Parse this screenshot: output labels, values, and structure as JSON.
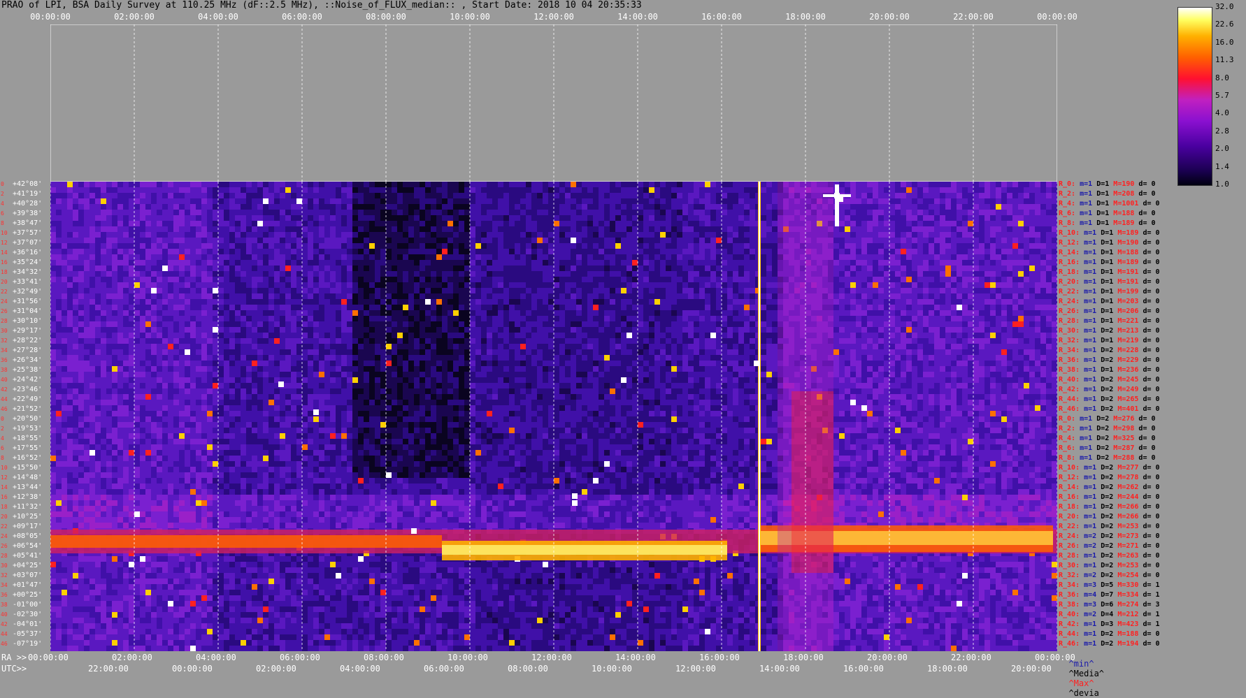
{
  "title": "PRAO of LPI, BSA Daily Survey at 110.25 MHz (dF::2.5 MHz), ::Noise_of_FLUX_median:: , Start Date: 2018 10 04 20:35:33",
  "top_axis": [
    "00:00:00",
    "02:00:00",
    "04:00:00",
    "06:00:00",
    "08:00:00",
    "10:00:00",
    "12:00:00",
    "14:00:00",
    "16:00:00",
    "18:00:00",
    "20:00:00",
    "22:00:00",
    "00:00:00"
  ],
  "bottom_ra_label": "RA >>",
  "bottom_ra": [
    "00:00:00",
    "02:00:00",
    "04:00:00",
    "06:00:00",
    "08:00:00",
    "10:00:00",
    "12:00:00",
    "14:00:00",
    "16:00:00",
    "18:00:00",
    "20:00:00",
    "22:00:00",
    "00:00:00"
  ],
  "bottom_utc_label": "UTC>>",
  "bottom_utc": [
    "22:00:00",
    "00:00:00",
    "02:00:00",
    "04:00:00",
    "06:00:00",
    "08:00:00",
    "10:00:00",
    "12:00:00",
    "14:00:00",
    "16:00:00",
    "18:00:00",
    "20:00:00"
  ],
  "colorbar": {
    "labels": [
      "32.0",
      "22.6",
      "16.0",
      "11.3",
      "8.0",
      "5.7",
      "4.0",
      "2.8",
      "2.0",
      "1.4",
      "1.0"
    ]
  },
  "declinations": [
    "+42°08'",
    "+41°19'",
    "+40°28'",
    "+39°38'",
    "+38°47'",
    "+37°57'",
    "+37°07'",
    "+36°16'",
    "+35°24'",
    "+34°32'",
    "+33°41'",
    "+32°49'",
    "+31°56'",
    "+31°04'",
    "+30°10'",
    "+29°17'",
    "+28°22'",
    "+27°28'",
    "+26°34'",
    "+25°38'",
    "+24°42'",
    "+23°46'",
    "+22°49'",
    "+21°52'",
    "+20°50'",
    "+19°53'",
    "+18°55'",
    "+17°55'",
    "+16°52'",
    "+15°50'",
    "+14°48'",
    "+13°44'",
    "+12°38'",
    "+11°32'",
    "+10°25'",
    "+09°17'",
    "+08°05'",
    "+06°54'",
    "+05°41'",
    "+04°25'",
    "+03°07'",
    "+01°47'",
    "+00°25'",
    "-01°00'",
    "-02°30'",
    "-04°01'",
    "-05°37'",
    "-07°19'"
  ],
  "row_index": [
    "0",
    "2",
    "4",
    "6",
    "8",
    "10",
    "12",
    "14",
    "16",
    "18",
    "20",
    "22",
    "24",
    "26",
    "28",
    "30",
    "32",
    "34",
    "36",
    "38",
    "40",
    "42",
    "44",
    "46",
    "0",
    "2",
    "4",
    "6",
    "8",
    "10",
    "12",
    "14",
    "16",
    "18",
    "20",
    "22",
    "24",
    "26",
    "28",
    "30",
    "32",
    "34",
    "36",
    "38",
    "40",
    "42",
    "44",
    "46"
  ],
  "stats": [
    {
      "r": "R_0:",
      "m": "m=1",
      "d": "D=1",
      "M": "M=190",
      "dev": "d= 0"
    },
    {
      "r": "R_2:",
      "m": "m=1",
      "d": "D=1",
      "M": "M=208",
      "dev": "d= 0"
    },
    {
      "r": "R_4:",
      "m": "m=1",
      "d": "D=1",
      "M": "M=1001",
      "dev": "d= 0"
    },
    {
      "r": "R_6:",
      "m": "m=1",
      "d": "D=1",
      "M": "M=188",
      "dev": "d= 0"
    },
    {
      "r": "R_8:",
      "m": "m=1",
      "d": "D=1",
      "M": "M=189",
      "dev": "d= 0"
    },
    {
      "r": "R_10:",
      "m": "m=1",
      "d": "D=1",
      "M": "M=189",
      "dev": "d= 0"
    },
    {
      "r": "R_12:",
      "m": "m=1",
      "d": "D=1",
      "M": "M=190",
      "dev": "d= 0"
    },
    {
      "r": "R_14:",
      "m": "m=1",
      "d": "D=1",
      "M": "M=188",
      "dev": "d= 0"
    },
    {
      "r": "R_16:",
      "m": "m=1",
      "d": "D=1",
      "M": "M=189",
      "dev": "d= 0"
    },
    {
      "r": "R_18:",
      "m": "m=1",
      "d": "D=1",
      "M": "M=191",
      "dev": "d= 0"
    },
    {
      "r": "R_20:",
      "m": "m=1",
      "d": "D=1",
      "M": "M=191",
      "dev": "d= 0"
    },
    {
      "r": "R_22:",
      "m": "m=1",
      "d": "D=1",
      "M": "M=199",
      "dev": "d= 0"
    },
    {
      "r": "R_24:",
      "m": "m=1",
      "d": "D=1",
      "M": "M=203",
      "dev": "d= 0"
    },
    {
      "r": "R_26:",
      "m": "m=1",
      "d": "D=1",
      "M": "M=206",
      "dev": "d= 0"
    },
    {
      "r": "R_28:",
      "m": "m=1",
      "d": "D=1",
      "M": "M=221",
      "dev": "d= 0"
    },
    {
      "r": "R_30:",
      "m": "m=1",
      "d": "D=2",
      "M": "M=213",
      "dev": "d= 0"
    },
    {
      "r": "R_32:",
      "m": "m=1",
      "d": "D=1",
      "M": "M=219",
      "dev": "d= 0"
    },
    {
      "r": "R_34:",
      "m": "m=1",
      "d": "D=2",
      "M": "M=228",
      "dev": "d= 0"
    },
    {
      "r": "R_36:",
      "m": "m=1",
      "d": "D=2",
      "M": "M=229",
      "dev": "d= 0"
    },
    {
      "r": "R_38:",
      "m": "m=1",
      "d": "D=1",
      "M": "M=236",
      "dev": "d= 0"
    },
    {
      "r": "R_40:",
      "m": "m=1",
      "d": "D=2",
      "M": "M=245",
      "dev": "d= 0"
    },
    {
      "r": "R_42:",
      "m": "m=1",
      "d": "D=2",
      "M": "M=249",
      "dev": "d= 0"
    },
    {
      "r": "R_44:",
      "m": "m=1",
      "d": "D=2",
      "M": "M=265",
      "dev": "d= 0"
    },
    {
      "r": "R_46:",
      "m": "m=1",
      "d": "D=2",
      "M": "M=401",
      "dev": "d= 0"
    },
    {
      "r": "R_0:",
      "m": "m=1",
      "d": "D=2",
      "M": "M=276",
      "dev": "d= 0"
    },
    {
      "r": "R_2:",
      "m": "m=1",
      "d": "D=2",
      "M": "M=298",
      "dev": "d= 0"
    },
    {
      "r": "R_4:",
      "m": "m=1",
      "d": "D=2",
      "M": "M=325",
      "dev": "d= 0"
    },
    {
      "r": "R_6:",
      "m": "m=1",
      "d": "D=2",
      "M": "M=287",
      "dev": "d= 0"
    },
    {
      "r": "R_8:",
      "m": "m=1",
      "d": "D=2",
      "M": "M=288",
      "dev": "d= 0"
    },
    {
      "r": "R_10:",
      "m": "m=1",
      "d": "D=2",
      "M": "M=277",
      "dev": "d= 0"
    },
    {
      "r": "R_12:",
      "m": "m=1",
      "d": "D=2",
      "M": "M=278",
      "dev": "d= 0"
    },
    {
      "r": "R_14:",
      "m": "m=1",
      "d": "D=2",
      "M": "M=262",
      "dev": "d= 0"
    },
    {
      "r": "R_16:",
      "m": "m=1",
      "d": "D=2",
      "M": "M=244",
      "dev": "d= 0"
    },
    {
      "r": "R_18:",
      "m": "m=1",
      "d": "D=2",
      "M": "M=266",
      "dev": "d= 0"
    },
    {
      "r": "R_20:",
      "m": "m=1",
      "d": "D=2",
      "M": "M=266",
      "dev": "d= 0"
    },
    {
      "r": "R_22:",
      "m": "m=1",
      "d": "D=2",
      "M": "M=253",
      "dev": "d= 0"
    },
    {
      "r": "R_24:",
      "m": "m=2",
      "d": "D=2",
      "M": "M=273",
      "dev": "d= 0"
    },
    {
      "r": "R_26:",
      "m": "m=2",
      "d": "D=2",
      "M": "M=271",
      "dev": "d= 0"
    },
    {
      "r": "R_28:",
      "m": "m=1",
      "d": "D=2",
      "M": "M=263",
      "dev": "d= 0"
    },
    {
      "r": "R_30:",
      "m": "m=1",
      "d": "D=2",
      "M": "M=253",
      "dev": "d= 0"
    },
    {
      "r": "R_32:",
      "m": "m=2",
      "d": "D=2",
      "M": "M=254",
      "dev": "d= 0"
    },
    {
      "r": "R_34:",
      "m": "m=3",
      "d": "D=5",
      "M": "M=330",
      "dev": "d= 1"
    },
    {
      "r": "R_36:",
      "m": "m=4",
      "d": "D=7",
      "M": "M=334",
      "dev": "d= 1"
    },
    {
      "r": "R_38:",
      "m": "m=3",
      "d": "D=6",
      "M": "M=274",
      "dev": "d= 3"
    },
    {
      "r": "R_40:",
      "m": "m=2",
      "d": "D=4",
      "M": "M=212",
      "dev": "d= 1"
    },
    {
      "r": "R_42:",
      "m": "m=1",
      "d": "D=3",
      "M": "M=423",
      "dev": "d= 1"
    },
    {
      "r": "R_44:",
      "m": "m=1",
      "d": "D=2",
      "M": "M=188",
      "dev": "d= 0"
    },
    {
      "r": "R_46:",
      "m": "m=1",
      "d": "D=2",
      "M": "M=194",
      "dev": "d= 0"
    }
  ],
  "legend": {
    "min": "^min^",
    "median": "^Media^",
    "max": "^Max^",
    "devia": "^devia"
  },
  "colors": {
    "background": "#9a9a9a",
    "red_label": "#ff2020",
    "blue_label": "#1a1aaa"
  }
}
